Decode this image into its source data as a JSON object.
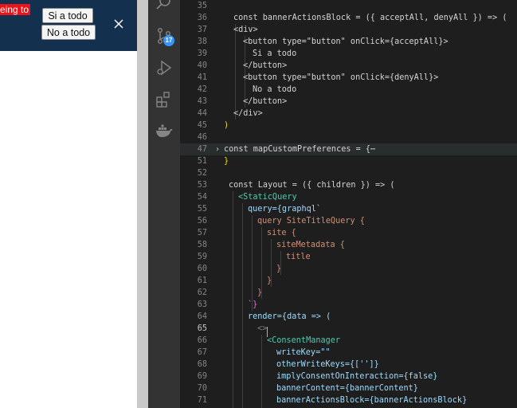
{
  "browser": {
    "banner_text": "eing to",
    "accept_label": "Si a todo",
    "deny_label": "No a todo",
    "close_icon": "close-icon"
  },
  "activity_bar": {
    "icons": [
      "search-icon",
      "source-control-icon",
      "run-debug-icon",
      "extensions-icon",
      "docker-icon"
    ],
    "source_control_badge": "17"
  },
  "editor": {
    "current_line": "65",
    "lines": [
      {
        "n": "35",
        "text": ""
      },
      {
        "n": "36",
        "text": "const bannerActionsBlock = ({ acceptAll, denyAll }) => ("
      },
      {
        "n": "37",
        "text": "<div>"
      },
      {
        "n": "38",
        "text": "<button type=\"button\" onClick={acceptAll}>"
      },
      {
        "n": "39",
        "text": "Si a todo"
      },
      {
        "n": "40",
        "text": "</button>"
      },
      {
        "n": "41",
        "text": "<button type=\"button\" onClick={denyAll}>"
      },
      {
        "n": "42",
        "text": "No a todo"
      },
      {
        "n": "43",
        "text": "</button>"
      },
      {
        "n": "44",
        "text": "</div>"
      },
      {
        "n": "45",
        "text": ")"
      },
      {
        "n": "46",
        "text": ""
      },
      {
        "n": "47",
        "text": "const mapCustomPreferences = {⋯"
      },
      {
        "n": "51",
        "text": "}"
      },
      {
        "n": "52",
        "text": ""
      },
      {
        "n": "53",
        "text": "const Layout = ({ children }) => ("
      },
      {
        "n": "54",
        "text": "<StaticQuery"
      },
      {
        "n": "55",
        "text": "query={graphql`"
      },
      {
        "n": "56",
        "text": "query SiteTitleQuery {"
      },
      {
        "n": "57",
        "text": "site {"
      },
      {
        "n": "58",
        "text": "siteMetadata {"
      },
      {
        "n": "59",
        "text": "title"
      },
      {
        "n": "60",
        "text": "}"
      },
      {
        "n": "61",
        "text": "}"
      },
      {
        "n": "62",
        "text": "}"
      },
      {
        "n": "63",
        "text": "`}"
      },
      {
        "n": "64",
        "text": "render={data => ("
      },
      {
        "n": "65",
        "text": "<>"
      },
      {
        "n": "66",
        "text": "<ConsentManager"
      },
      {
        "n": "67",
        "text": "writeKey=\"\""
      },
      {
        "n": "68",
        "text": "otherWriteKeys={['']}"
      },
      {
        "n": "69",
        "text": "implyConsentOnInteraction={false}"
      },
      {
        "n": "70",
        "text": "bannerContent={bannerContent}"
      },
      {
        "n": "71",
        "text": "bannerActionsBlock={bannerActionsBlock}"
      }
    ]
  }
}
